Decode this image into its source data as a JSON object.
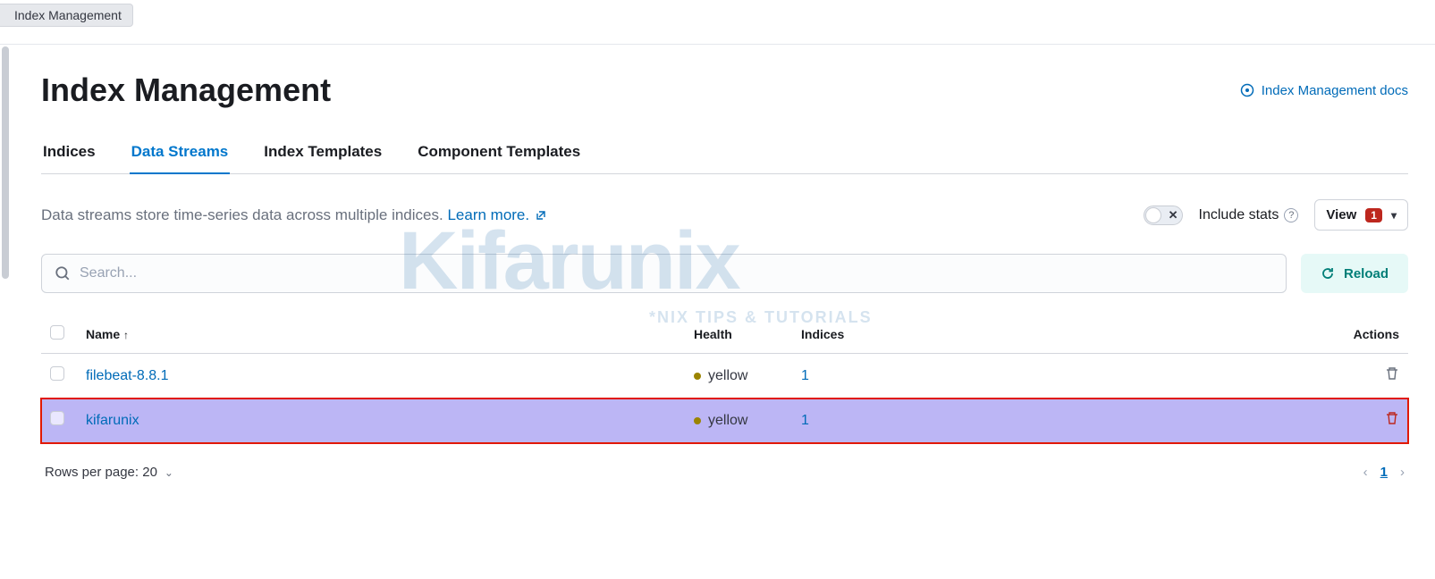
{
  "breadcrumb": {
    "label": "Index Management"
  },
  "header": {
    "title": "Index Management",
    "docs_link": "Index Management docs"
  },
  "tabs": [
    {
      "id": "indices",
      "label": "Indices",
      "active": false
    },
    {
      "id": "streams",
      "label": "Data Streams",
      "active": true
    },
    {
      "id": "itpl",
      "label": "Index Templates",
      "active": false
    },
    {
      "id": "ctpl",
      "label": "Component Templates",
      "active": false
    }
  ],
  "description": {
    "text": "Data streams store time-series data across multiple indices. ",
    "learn_more": "Learn more."
  },
  "controls": {
    "include_stats_label": "Include stats",
    "view_label": "View",
    "view_badge": "1"
  },
  "search": {
    "placeholder": "Search..."
  },
  "reload_label": "Reload",
  "columns": {
    "name": "Name",
    "health": "Health",
    "indices": "Indices",
    "actions": "Actions"
  },
  "rows": [
    {
      "name": "filebeat-8.8.1",
      "health": "yellow",
      "indices": "1",
      "highlight": false
    },
    {
      "name": "kifarunix",
      "health": "yellow",
      "indices": "1",
      "highlight": true
    }
  ],
  "footer": {
    "rows_per_page": "Rows per page: 20",
    "page": "1"
  },
  "watermark": {
    "big": "Kifarunix",
    "small": "*NIX TIPS & TUTORIALS"
  }
}
